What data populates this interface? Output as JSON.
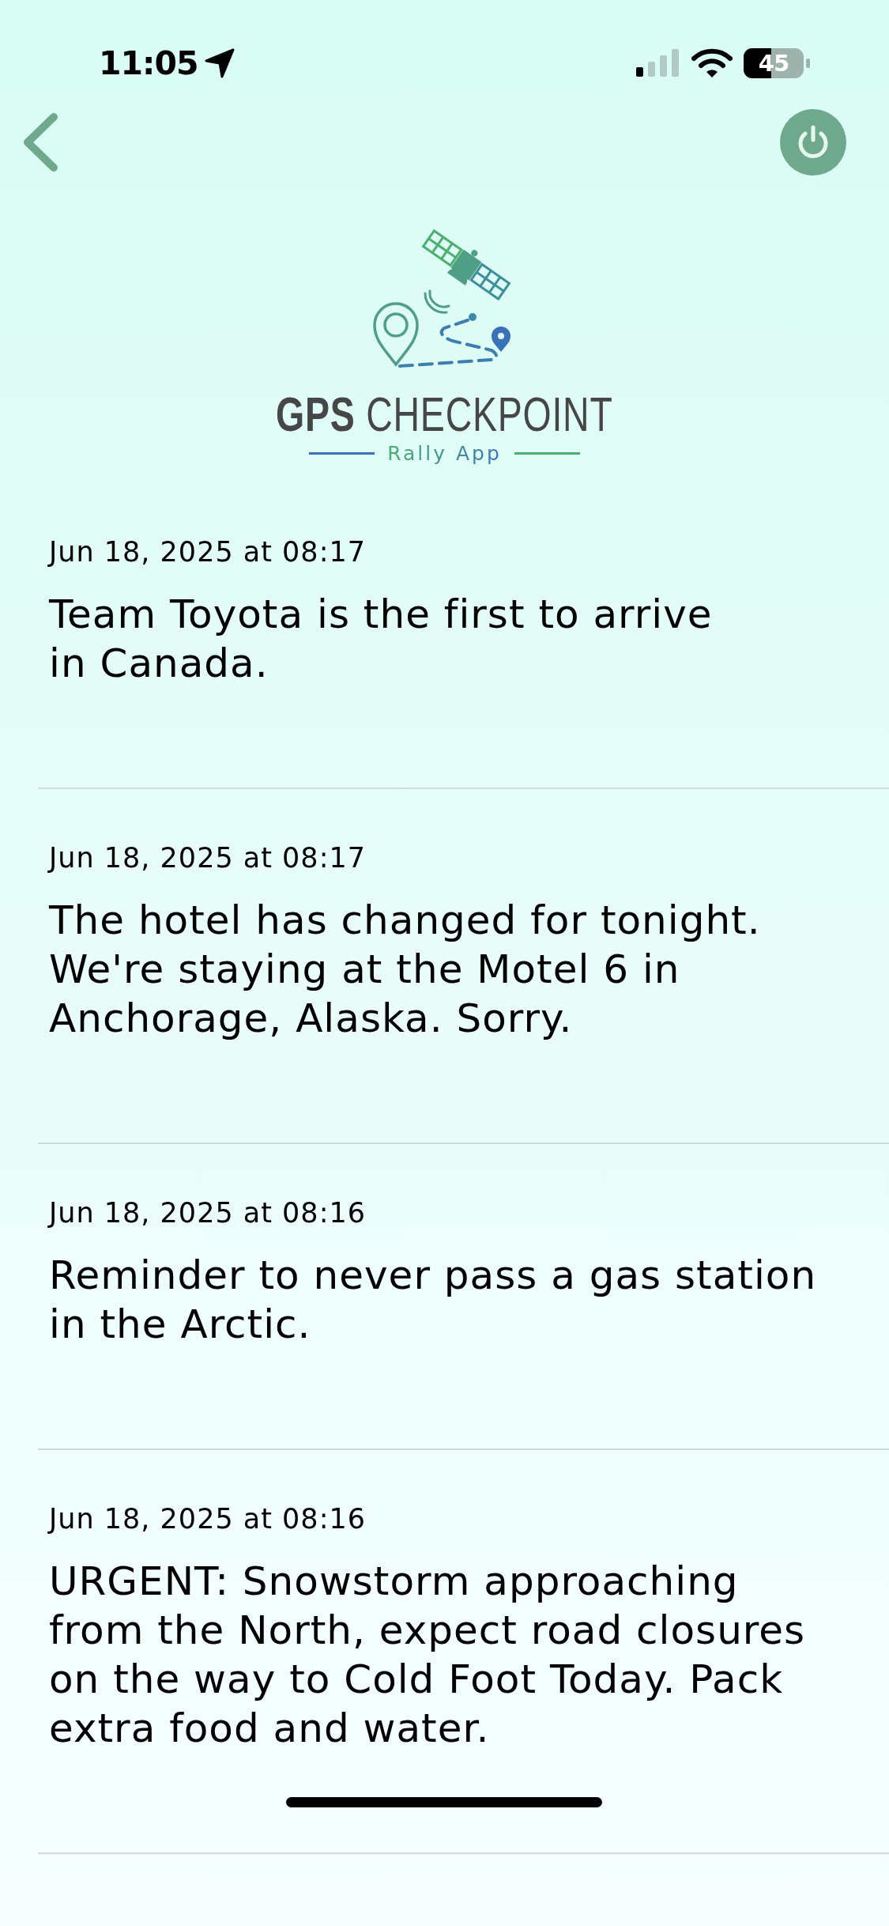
{
  "status_bar": {
    "time": "11:05",
    "battery": "45"
  },
  "logo": {
    "title": "**GPS** CHECKPOINT",
    "subtitle": "Rally App"
  },
  "messages": [
    {
      "date": "Jun 18, 2025 at 08:17",
      "text": "Team Toyota is the first to arrive\nin Canada."
    },
    {
      "date": "Jun 18, 2025 at 08:17",
      "text": "The hotel has changed for tonight. We're staying at the Motel 6 in Anchorage, Alaska. Sorry."
    },
    {
      "date": "Jun 18, 2025 at 08:16",
      "text": "Reminder to never pass a gas station in the Arctic."
    },
    {
      "date": "Jun 18, 2025 at 08:16",
      "text": "URGENT: Snowstorm approaching from the North, expect road closures on the way to Cold Foot Today. Pack extra food and water."
    }
  ]
}
